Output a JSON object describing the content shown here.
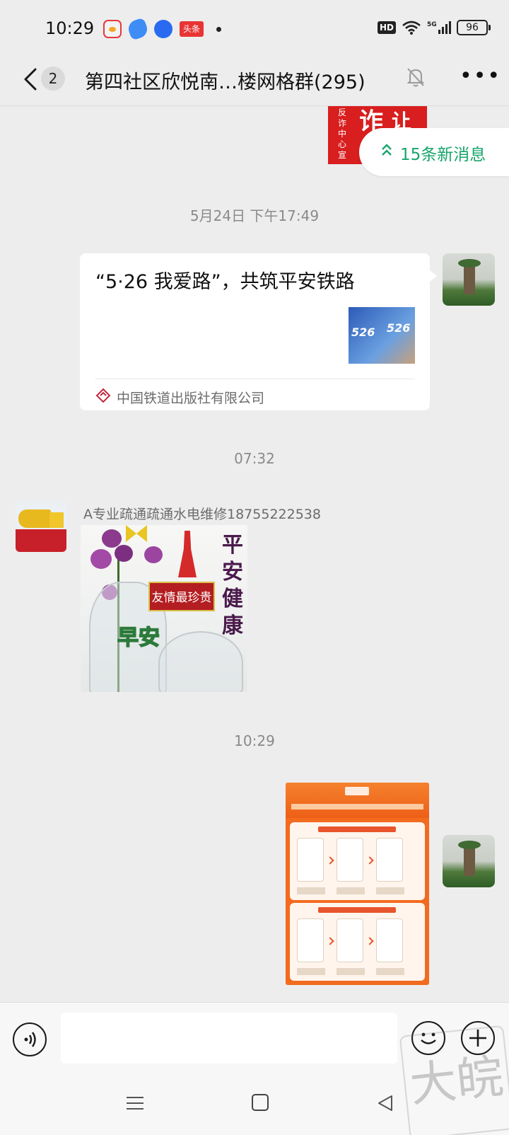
{
  "status_bar": {
    "time": "10:29",
    "app_icons": [
      "weibo-icon",
      "feather-app-icon",
      "baidu-icon",
      "toutiao-icon"
    ],
    "toutiao_label": "头条",
    "network": "5G",
    "hd_label": "HD",
    "battery": "96"
  },
  "header": {
    "unread_count": "2",
    "title": "第四社区欣悦南…楼网格群(295)",
    "icons": [
      "back-icon",
      "mute-bell-icon",
      "more-icon"
    ]
  },
  "new_messages_pill": {
    "label": "15条新消息",
    "color": "#17a56b"
  },
  "top_image_text": {
    "vertical": "反诈中心宣",
    "big1": "诈",
    "big2": "让"
  },
  "messages": [
    {
      "timestamp": "5月24日 下午17:49",
      "type": "link_card",
      "from_self": true,
      "title": "“5·26 我爱路”，共筑平安铁路",
      "thumb_text": [
        "526",
        "526"
      ],
      "source": "中国铁道出版社有限公司"
    },
    {
      "timestamp": "07:32",
      "type": "image",
      "from_self": false,
      "sender": "A专业疏通疏通水电维修18755222538",
      "image_text": {
        "banner": "友情最珍贵",
        "side": "平安健康",
        "greeting": "早安"
      }
    },
    {
      "timestamp": "10:29",
      "type": "image",
      "from_self": true,
      "description_icon": "orange-poster"
    }
  ],
  "input_bar": {
    "placeholder": "",
    "icons": [
      "voice-icon",
      "emoji-icon",
      "plus-icon"
    ]
  },
  "nav_bar": {
    "icons": [
      "menu-icon",
      "home-icon",
      "back-triangle-icon"
    ]
  },
  "watermark_text": "大皖",
  "colors": {
    "background": "#ededed",
    "accent_green": "#17a56b",
    "poster_orange": "#f26b1f"
  }
}
